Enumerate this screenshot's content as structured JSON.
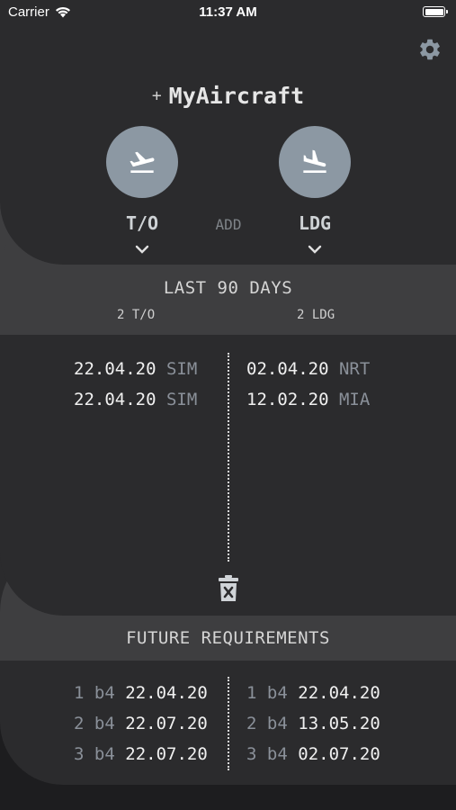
{
  "status_bar": {
    "carrier": "Carrier",
    "time": "11:37 AM"
  },
  "header": {
    "plus": "+",
    "title": "MyAircraft"
  },
  "actions": {
    "takeoff": {
      "label": "T/O",
      "icon": "flight-takeoff-icon"
    },
    "add_label": "ADD",
    "landing": {
      "label": "LDG",
      "icon": "flight-land-icon"
    }
  },
  "last90": {
    "title": "LAST 90 DAYS",
    "takeoff_count": "2 T/O",
    "landing_count": "2 LDG",
    "takeoffs": [
      {
        "date": "22.04.20",
        "tag": "SIM"
      },
      {
        "date": "22.04.20",
        "tag": "SIM"
      }
    ],
    "landings": [
      {
        "date": "02.04.20",
        "tag": "NRT"
      },
      {
        "date": "12.02.20",
        "tag": "MIA"
      }
    ]
  },
  "future": {
    "title": "FUTURE REQUIREMENTS",
    "takeoff": [
      {
        "n": "1",
        "b4": "b4",
        "date": "22.04.20"
      },
      {
        "n": "2",
        "b4": "b4",
        "date": "22.07.20"
      },
      {
        "n": "3",
        "b4": "b4",
        "date": "22.07.20"
      }
    ],
    "landing": [
      {
        "n": "1",
        "b4": "b4",
        "date": "22.04.20"
      },
      {
        "n": "2",
        "b4": "b4",
        "date": "13.05.20"
      },
      {
        "n": "3",
        "b4": "b4",
        "date": "02.07.20"
      }
    ]
  },
  "colors": {
    "accent": "#8c98a3",
    "background": "#2b2b2d",
    "band": "#3e3e40"
  }
}
